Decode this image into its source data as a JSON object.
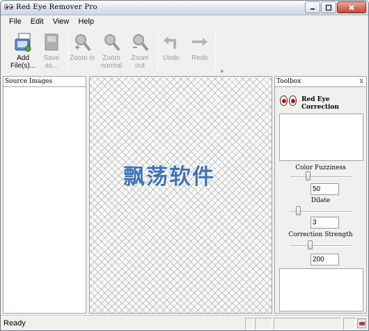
{
  "window": {
    "title": "Red Eye Remover Pro",
    "controls": [
      "minimize-icon",
      "maximize-icon",
      "close-icon"
    ]
  },
  "menu": {
    "items": [
      "File",
      "Edit",
      "View",
      "Help"
    ]
  },
  "toolbar": {
    "buttons": [
      {
        "label": "Add File(s)...",
        "icon": "add-file-icon",
        "enabled": true
      },
      {
        "label": "Save as...",
        "icon": "save-icon",
        "enabled": false
      },
      {
        "label": "Zoom in",
        "icon": "zoom-in-icon",
        "enabled": false
      },
      {
        "label": "Zoom normal",
        "icon": "zoom-normal-icon",
        "enabled": false
      },
      {
        "label": "Zoom out",
        "icon": "zoom-out-icon",
        "enabled": false
      },
      {
        "label": "Undo",
        "icon": "undo-icon",
        "enabled": false
      },
      {
        "label": "Redo",
        "icon": "redo-icon",
        "enabled": false
      }
    ]
  },
  "source_panel": {
    "title": "Source Images"
  },
  "canvas": {
    "watermark": "飘荡软件"
  },
  "toolbox": {
    "title": "Toolbox",
    "close": "x",
    "tool_title": "Red Eye Correction",
    "controls": [
      {
        "label": "Color Fuzziness",
        "value": "50",
        "level": 0.28
      },
      {
        "label": "Dilate",
        "value": "3",
        "level": 0.12
      },
      {
        "label": "Correction Strength",
        "value": "200",
        "level": 0.32
      }
    ]
  },
  "status": {
    "text": "Ready"
  },
  "colors": {
    "accent": "#3f74b5",
    "red_eye": "#cc0000"
  }
}
